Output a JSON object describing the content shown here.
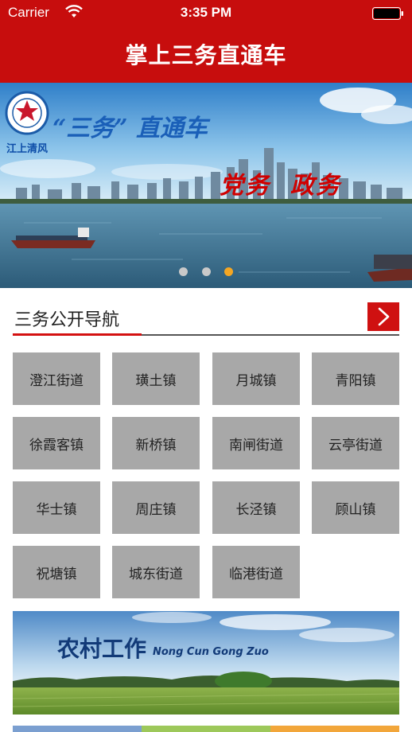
{
  "status_bar": {
    "carrier": "Carrier",
    "time": "3:35 PM"
  },
  "header": {
    "title": "掌上三务直通车"
  },
  "banner": {
    "logo_text": "江上清风",
    "slogan": "“三务” 直通车",
    "tagline": "党务  政务",
    "slide_count": 3,
    "active_slide": 3
  },
  "nav": {
    "title": "三务公开导航",
    "more_icon": "chevron-right-icon"
  },
  "towns": [
    "澄江街道",
    "璜土镇",
    "月城镇",
    "青阳镇",
    "徐霞客镇",
    "新桥镇",
    "南闸街道",
    "云亭街道",
    "华士镇",
    "周庄镇",
    "长泾镇",
    "顾山镇",
    "祝塘镇",
    "城东街道",
    "临港街道"
  ],
  "rural_banner": {
    "title": "农村工作",
    "subtitle": "Nong Cun Gong Zuo"
  },
  "colors": {
    "brand_red": "#c70d0d",
    "tile_gray": "#a8a8a8",
    "active_dot": "#f5a623"
  }
}
